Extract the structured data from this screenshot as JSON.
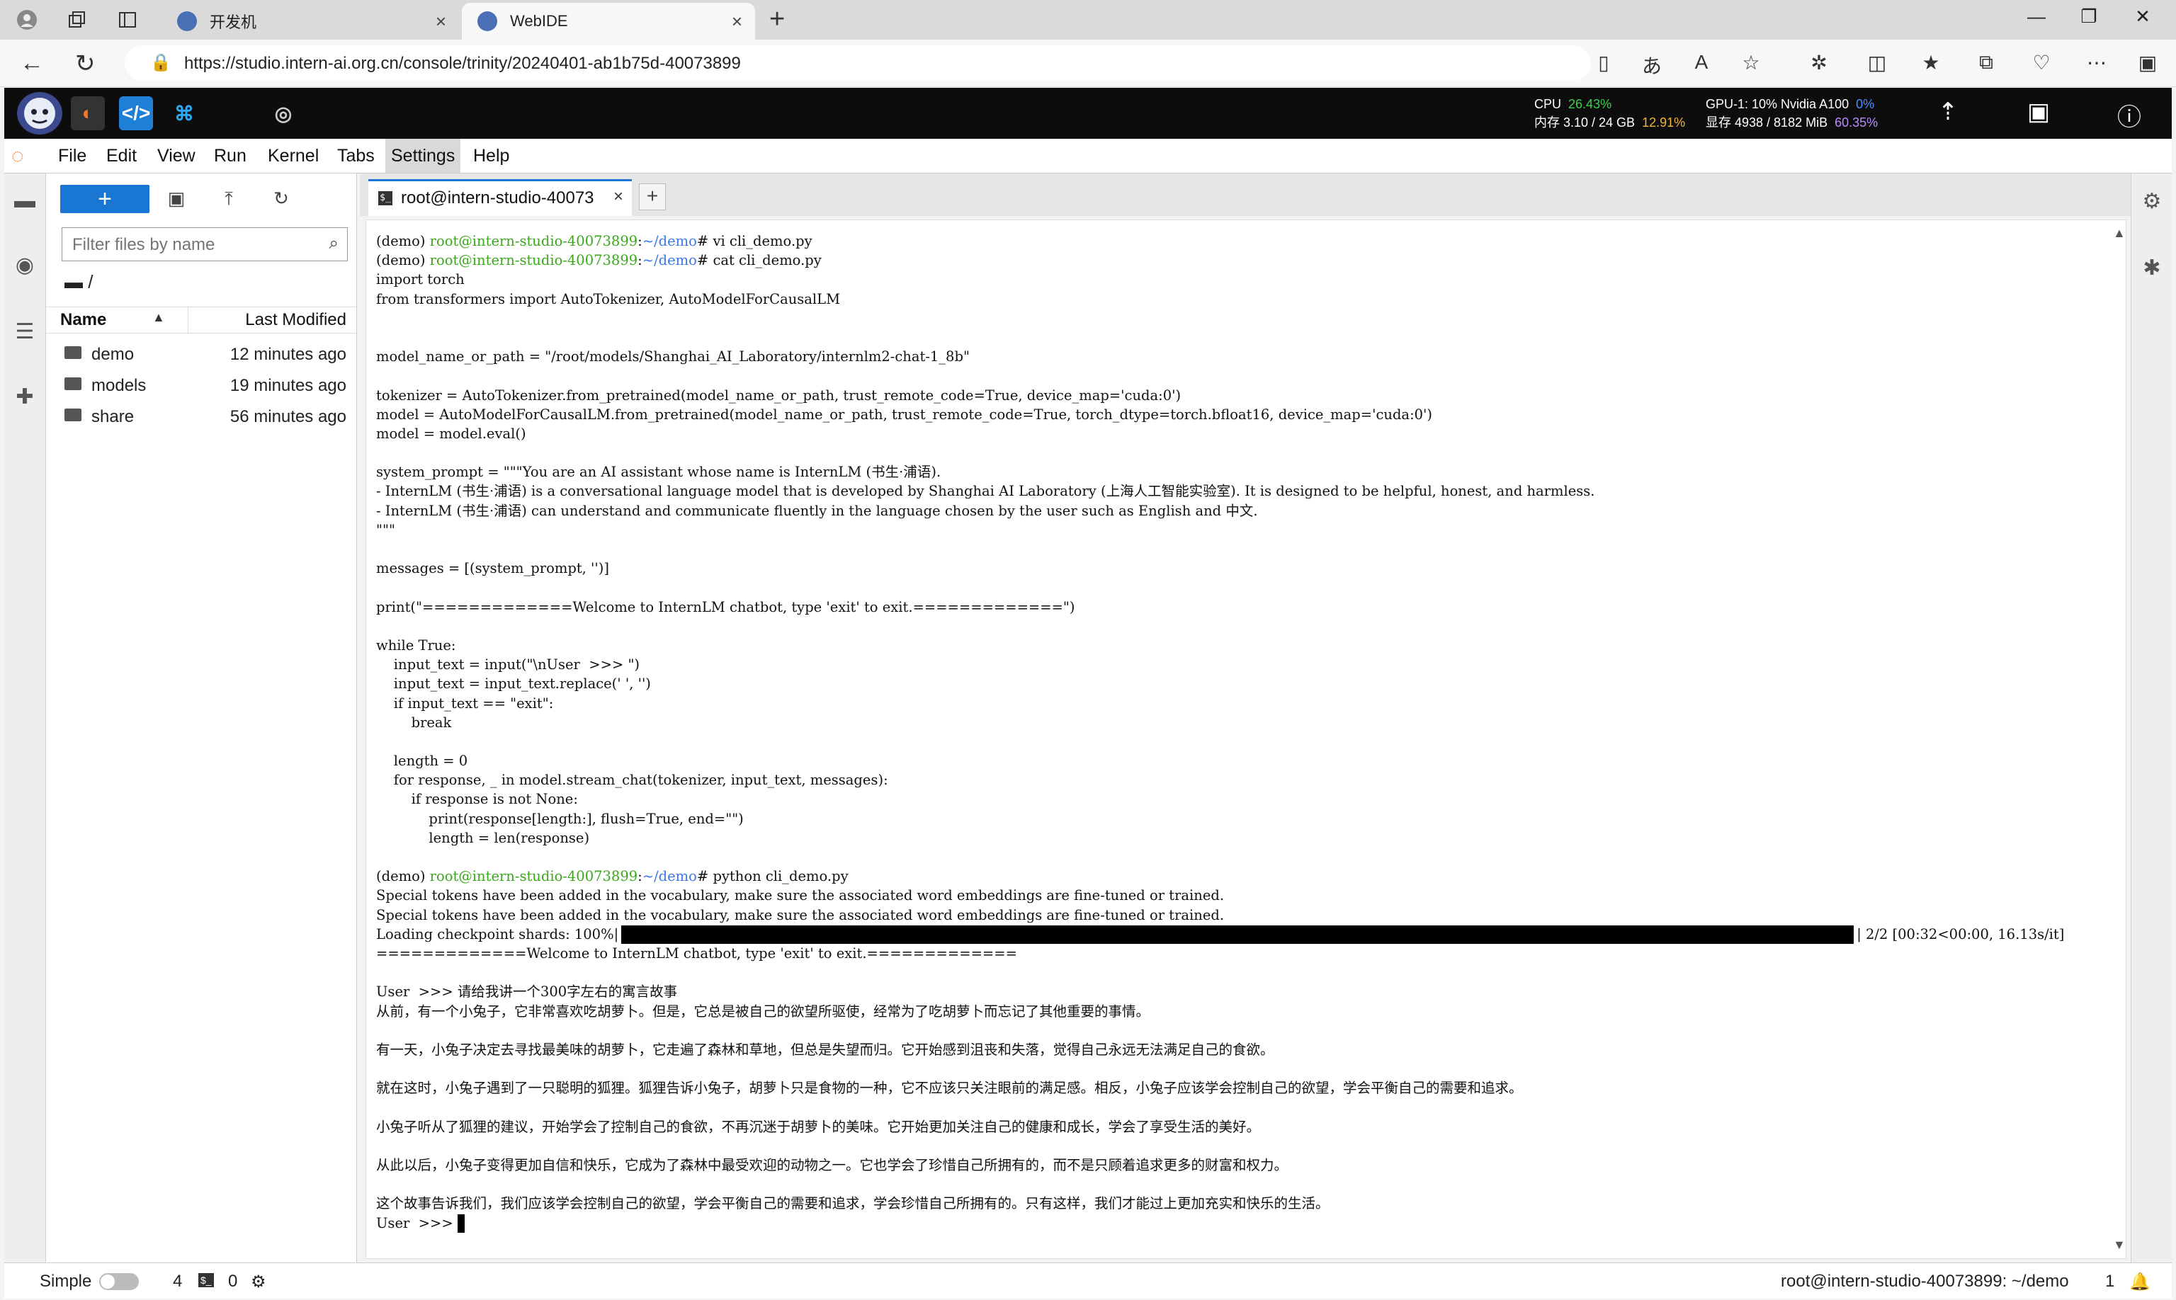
{
  "browser": {
    "tabs": [
      {
        "title": "开发机",
        "active": false
      },
      {
        "title": "WebIDE",
        "active": true
      }
    ],
    "url": "https://studio.intern-ai.org.cn/console/trinity/20240401-ab1b75d-40073899"
  },
  "ide_bar": {
    "cpu_label": "CPU",
    "cpu_value": "26.43%",
    "mem_label": "内存 3.10 / 24 GB",
    "mem_value": "12.91%",
    "gpu_label": "GPU-1: 10% Nvidia A100",
    "gpu_value": "0%",
    "vram_label": "显存 4938 / 8182 MiB",
    "vram_value": "60.35%"
  },
  "menu": {
    "items": [
      "File",
      "Edit",
      "View",
      "Run",
      "Kernel",
      "Tabs",
      "Settings",
      "Help"
    ],
    "active": "Settings"
  },
  "file_browser": {
    "new_label": "+",
    "filter_placeholder": "Filter files by name",
    "breadcrumb": "/",
    "col_name": "Name",
    "col_modified": "Last Modified",
    "files": [
      {
        "name": "demo",
        "modified": "12 minutes ago"
      },
      {
        "name": "models",
        "modified": "19 minutes ago"
      },
      {
        "name": "share",
        "modified": "56 minutes ago"
      }
    ]
  },
  "terminal_tab": {
    "title": "root@intern-studio-40073",
    "close": "×",
    "add": "+"
  },
  "terminal": {
    "lines": [
      {
        "env": "(demo) ",
        "user": "root@intern-studio-40073899",
        "sep": ":",
        "path": "~/demo",
        "cmd": "# vi cli_demo.py"
      },
      {
        "env": "(demo) ",
        "user": "root@intern-studio-40073899",
        "sep": ":",
        "path": "~/demo",
        "cmd": "# cat cli_demo.py"
      },
      {
        "text": "import torch"
      },
      {
        "text": "from transformers import AutoTokenizer, AutoModelForCausalLM"
      },
      {
        "text": ""
      },
      {
        "text": ""
      },
      {
        "text": "model_name_or_path = \"/root/models/Shanghai_AI_Laboratory/internlm2-chat-1_8b\""
      },
      {
        "text": ""
      },
      {
        "text": "tokenizer = AutoTokenizer.from_pretrained(model_name_or_path, trust_remote_code=True, device_map='cuda:0')"
      },
      {
        "text": "model = AutoModelForCausalLM.from_pretrained(model_name_or_path, trust_remote_code=True, torch_dtype=torch.bfloat16, device_map='cuda:0')"
      },
      {
        "text": "model = model.eval()"
      },
      {
        "text": ""
      },
      {
        "text": "system_prompt = \"\"\"You are an AI assistant whose name is InternLM (书生·浦语)."
      },
      {
        "text": "- InternLM (书生·浦语) is a conversational language model that is developed by Shanghai AI Laboratory (上海人工智能实验室). It is designed to be helpful, honest, and harmless."
      },
      {
        "text": "- InternLM (书生·浦语) can understand and communicate fluently in the language chosen by the user such as English and 中文."
      },
      {
        "text": "\"\"\""
      },
      {
        "text": ""
      },
      {
        "text": "messages = [(system_prompt, '')]"
      },
      {
        "text": ""
      },
      {
        "text": "print(\"=============Welcome to InternLM chatbot, type 'exit' to exit.=============\")"
      },
      {
        "text": ""
      },
      {
        "text": "while True:"
      },
      {
        "text": "    input_text = input(\"\\nUser  >>> \")"
      },
      {
        "text": "    input_text = input_text.replace(' ', '')"
      },
      {
        "text": "    if input_text == \"exit\":"
      },
      {
        "text": "        break"
      },
      {
        "text": ""
      },
      {
        "text": "    length = 0"
      },
      {
        "text": "    for response, _ in model.stream_chat(tokenizer, input_text, messages):"
      },
      {
        "text": "        if response is not None:"
      },
      {
        "text": "            print(response[length:], flush=True, end=\"\")"
      },
      {
        "text": "            length = len(response)"
      },
      {
        "text": ""
      },
      {
        "env": "(demo) ",
        "user": "root@intern-studio-40073899",
        "sep": ":",
        "path": "~/demo",
        "cmd": "# python cli_demo.py"
      },
      {
        "text": "Special tokens have been added in the vocabulary, make sure the associated word embeddings are fine-tuned or trained."
      },
      {
        "text": "Special tokens have been added in the vocabulary, make sure the associated word embeddings are fine-tuned or trained."
      },
      {
        "progress_label": "Loading checkpoint shards: 100%|",
        "progress_tail": "| 2/2 [00:32<00:00, 16.13s/it]",
        "progress": 1.0
      },
      {
        "text": "=============Welcome to InternLM chatbot, type 'exit' to exit.============="
      },
      {
        "text": ""
      },
      {
        "text": "User  >>> 请给我讲一个300字左右的寓言故事"
      },
      {
        "text": "从前，有一个小兔子，它非常喜欢吃胡萝卜。但是，它总是被自己的欲望所驱使，经常为了吃胡萝卜而忘记了其他重要的事情。"
      },
      {
        "text": ""
      },
      {
        "text": "有一天，小兔子决定去寻找最美味的胡萝卜，它走遍了森林和草地，但总是失望而归。它开始感到沮丧和失落，觉得自己永远无法满足自己的食欲。"
      },
      {
        "text": ""
      },
      {
        "text": "就在这时，小兔子遇到了一只聪明的狐狸。狐狸告诉小兔子，胡萝卜只是食物的一种，它不应该只关注眼前的满足感。相反，小兔子应该学会控制自己的欲望，学会平衡自己的需要和追求。"
      },
      {
        "text": ""
      },
      {
        "text": "小兔子听从了狐狸的建议，开始学会了控制自己的食欲，不再沉迷于胡萝卜的美味。它开始更加关注自己的健康和成长，学会了享受生活的美好。"
      },
      {
        "text": ""
      },
      {
        "text": "从此以后，小兔子变得更加自信和快乐，它成为了森林中最受欢迎的动物之一。它也学会了珍惜自己所拥有的，而不是只顾着追求更多的财富和权力。"
      },
      {
        "text": ""
      },
      {
        "text": "这个故事告诉我们，我们应该学会控制自己的欲望，学会平衡自己的需要和追求，学会珍惜自己所拥有的。只有这样，我们才能过上更加充实和快乐的生活。"
      },
      {
        "text": "User  >>> ",
        "cursor": true
      }
    ]
  },
  "statusbar": {
    "mode": "Simple",
    "count1": "4",
    "count2": "0",
    "terminal_path": "root@intern-studio-40073899: ~/demo",
    "notif_count": "1"
  }
}
